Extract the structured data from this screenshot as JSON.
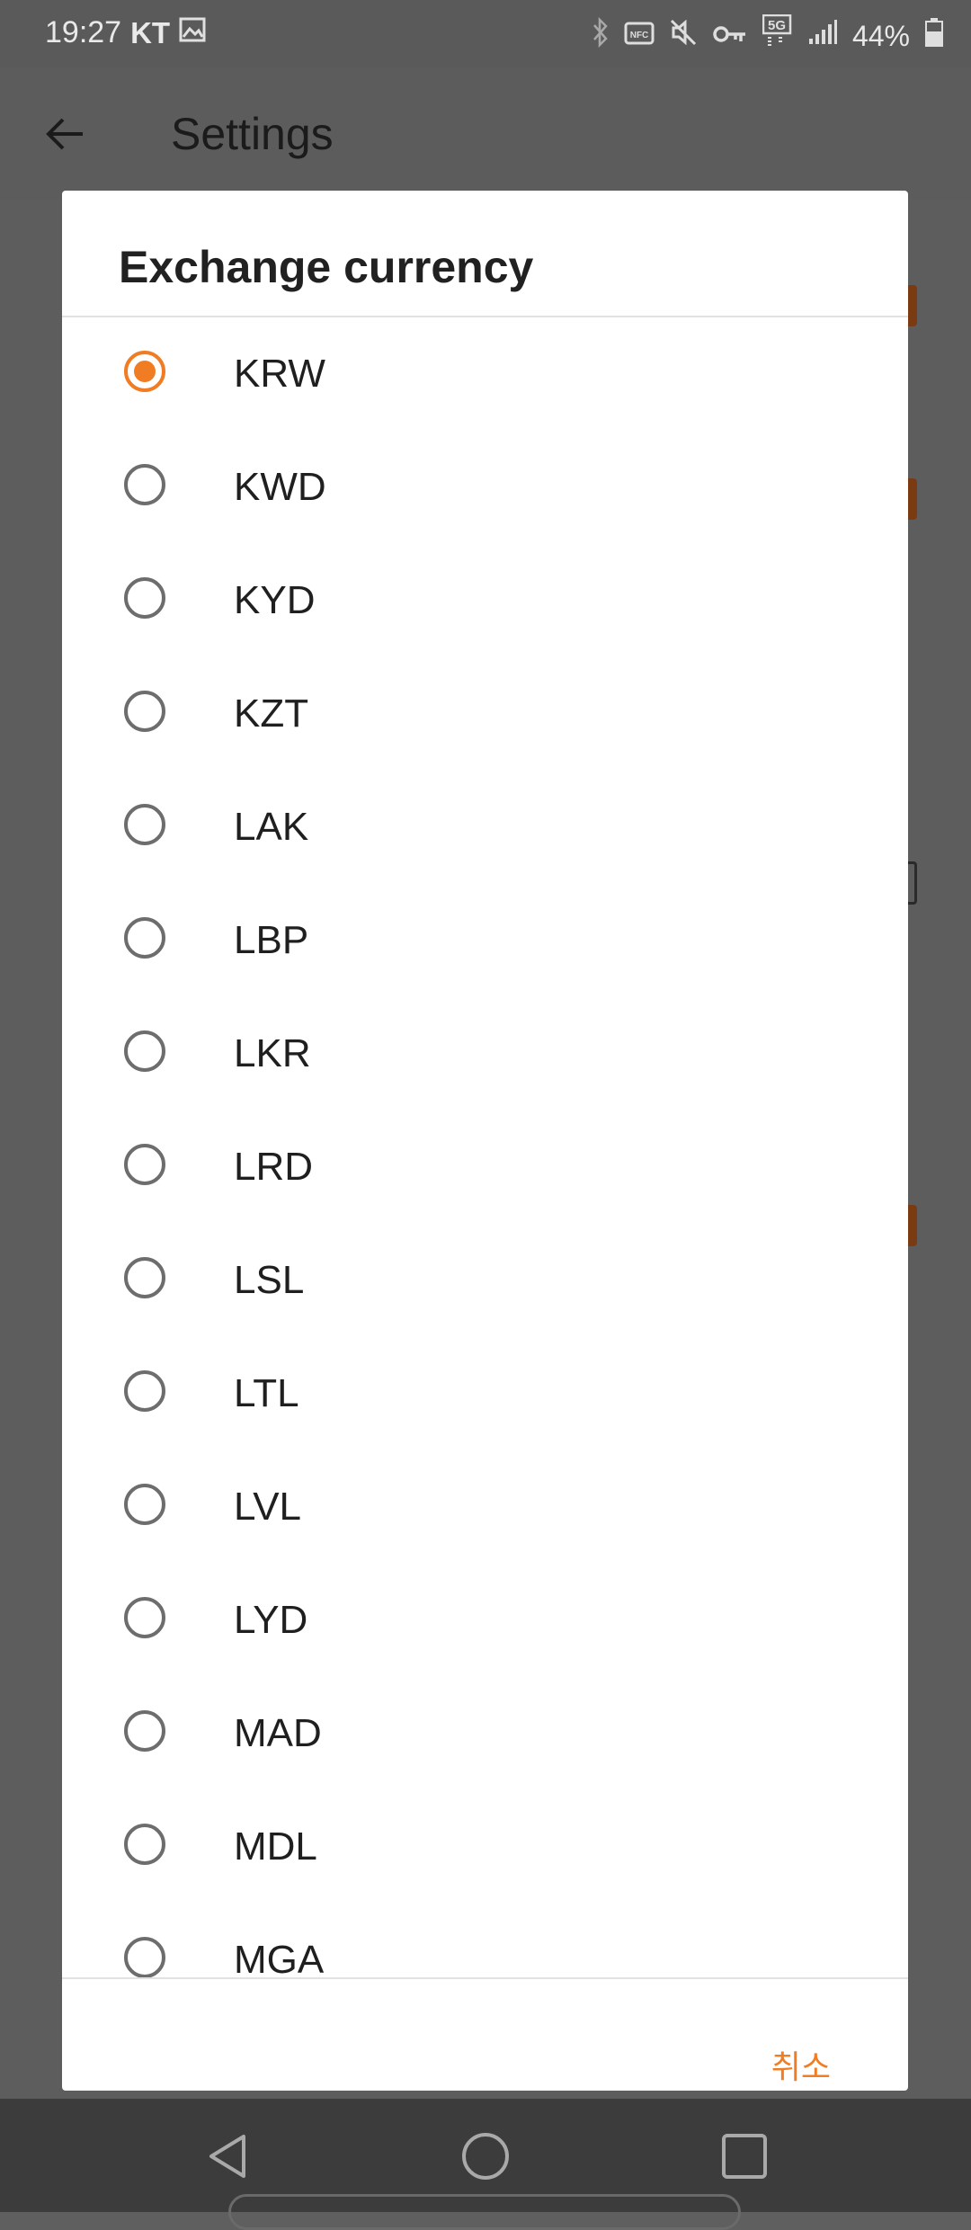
{
  "status_bar": {
    "time": "19:27",
    "carrier": "KT",
    "battery": "44%",
    "icons": [
      "image-icon",
      "bluetooth-icon",
      "nfc-icon",
      "mute-icon",
      "vpn-key-icon",
      "5g-icon",
      "signal-icon",
      "battery-icon"
    ],
    "network_label": "5G",
    "nfc_label": "NFC"
  },
  "app_bar": {
    "title": "Settings",
    "back_icon": "arrow-back-icon"
  },
  "dialog": {
    "title": "Exchange currency",
    "options": [
      {
        "label": "KRW",
        "selected": true
      },
      {
        "label": "KWD",
        "selected": false
      },
      {
        "label": "KYD",
        "selected": false
      },
      {
        "label": "KZT",
        "selected": false
      },
      {
        "label": "LAK",
        "selected": false
      },
      {
        "label": "LBP",
        "selected": false
      },
      {
        "label": "LKR",
        "selected": false
      },
      {
        "label": "LRD",
        "selected": false
      },
      {
        "label": "LSL",
        "selected": false
      },
      {
        "label": "LTL",
        "selected": false
      },
      {
        "label": "LVL",
        "selected": false
      },
      {
        "label": "LYD",
        "selected": false
      },
      {
        "label": "MAD",
        "selected": false
      },
      {
        "label": "MDL",
        "selected": false
      },
      {
        "label": "MGA",
        "selected": false
      }
    ],
    "cancel_label": "취소"
  },
  "colors": {
    "accent": "#f07c23",
    "scrim": "#5f5f5f",
    "dialog_bg": "#ffffff",
    "nav_bar": "#3c3c3c"
  },
  "nav_bar": {
    "buttons": [
      "back-triangle-icon",
      "home-circle-icon",
      "recents-square-icon"
    ]
  }
}
